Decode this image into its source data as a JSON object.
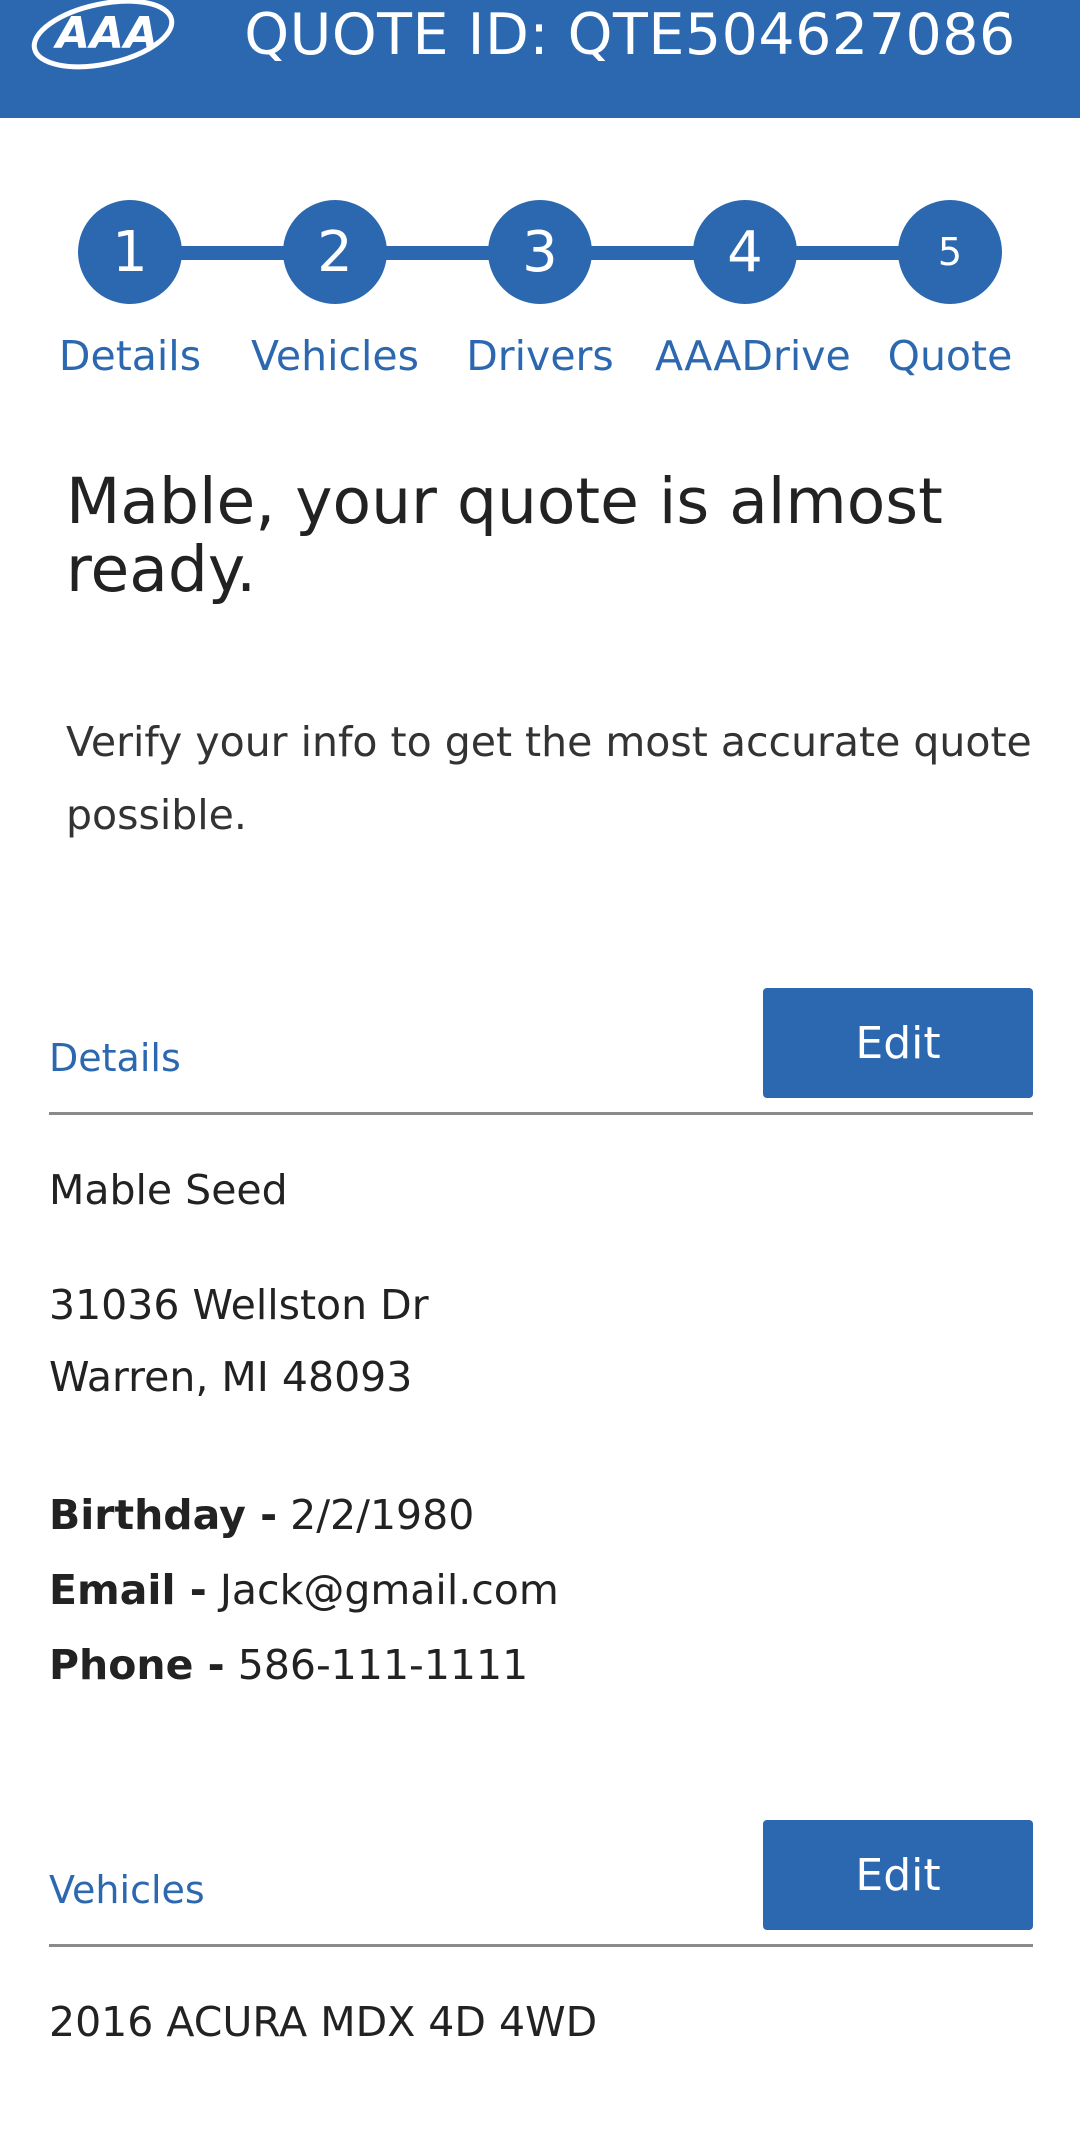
{
  "header": {
    "logo_text": "AAA",
    "quote_id_label": "QUOTE ID:",
    "quote_id_value": "QTE504627086",
    "background_color": "#2c68b0"
  },
  "stepper": {
    "steps": [
      {
        "number": "1",
        "label": "Details"
      },
      {
        "number": "2",
        "label": "Vehicles"
      },
      {
        "number": "3",
        "label": "Drivers"
      },
      {
        "number": "4",
        "label": "AAADrive"
      },
      {
        "number": "5",
        "label": "Quote"
      }
    ]
  },
  "main": {
    "heading": "Mable, your quote is almost ready.",
    "subtext": "Verify your info to get the most accurate quote possible."
  },
  "details_section": {
    "title": "Details",
    "edit_label": "Edit",
    "name": "Mable Seed",
    "address_line1": "31036 Wellston Dr",
    "address_line2": "Warren, MI 48093",
    "birthday_label": "Birthday -",
    "birthday_value": "2/2/1980",
    "email_label": "Email -",
    "email_value": "Jack@gmail.com",
    "phone_label": "Phone -",
    "phone_value": "586-111-1111"
  },
  "vehicles_section": {
    "title": "Vehicles",
    "edit_label": "Edit",
    "vehicle": "2016 ACURA MDX 4D 4WD"
  }
}
